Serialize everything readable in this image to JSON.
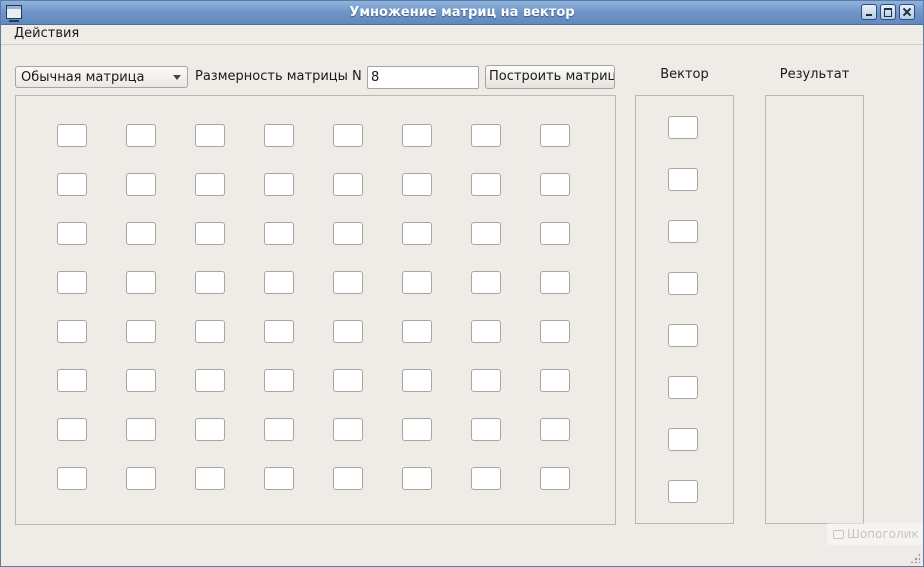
{
  "window": {
    "title": "Умножение матриц на вектор",
    "icon": "app-window-icon",
    "controls": [
      "minimize-icon",
      "maximize-icon",
      "close-icon"
    ]
  },
  "menu": {
    "actions_first_letter": "Д",
    "actions_rest": "ействия"
  },
  "toolbar": {
    "matrix_type": "Обычная матрица",
    "size_label": "Размерность матрицы N =",
    "size_value": "8",
    "build_label": "Построить матрицу"
  },
  "panels": {
    "vector_label": "Вектор",
    "result_label": "Результат"
  },
  "matrix": {
    "rows": 8,
    "cols": 8,
    "cells": [
      [
        "",
        "",
        "",
        "",
        "",
        "",
        "",
        ""
      ],
      [
        "",
        "",
        "",
        "",
        "",
        "",
        "",
        ""
      ],
      [
        "",
        "",
        "",
        "",
        "",
        "",
        "",
        ""
      ],
      [
        "",
        "",
        "",
        "",
        "",
        "",
        "",
        ""
      ],
      [
        "",
        "",
        "",
        "",
        "",
        "",
        "",
        ""
      ],
      [
        "",
        "",
        "",
        "",
        "",
        "",
        "",
        ""
      ],
      [
        "",
        "",
        "",
        "",
        "",
        "",
        "",
        ""
      ],
      [
        "",
        "",
        "",
        "",
        "",
        "",
        "",
        ""
      ]
    ]
  },
  "vector": {
    "cells": [
      "",
      "",
      "",
      "",
      "",
      "",
      "",
      ""
    ]
  },
  "watermark": "Шопоголик",
  "colors": {
    "titlebar": "#6e95c6",
    "window_bg": "#efebe7"
  }
}
